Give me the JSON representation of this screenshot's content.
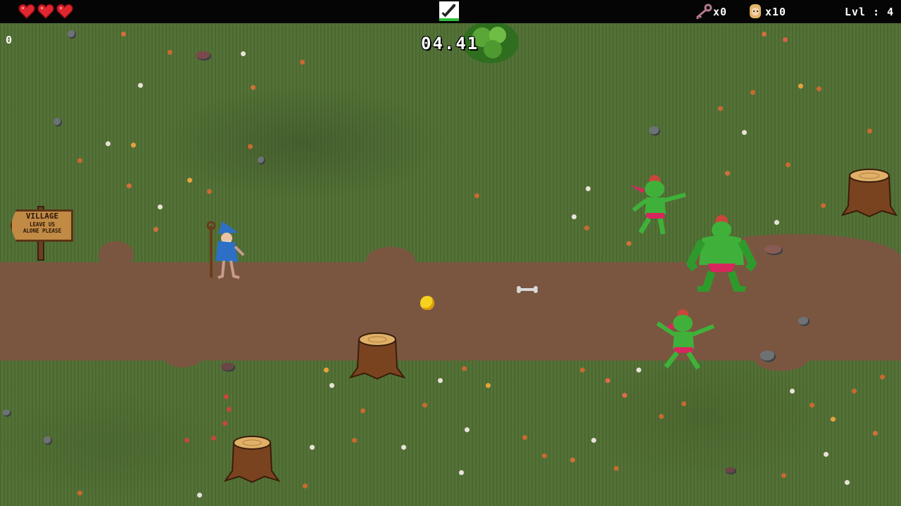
{
  "hud": {
    "hearts": 3,
    "weapon_icon": "sword-icon",
    "keys_label": "x0",
    "allies_label": "x10",
    "level_label": "Lvl : 4"
  },
  "counter": "0",
  "timer": "04.41",
  "sign": {
    "title": "VILLAGE",
    "subtitle_line1": "LEAVE US",
    "subtitle_line2": "ALONE PLEASE"
  },
  "colors": {
    "heart": "#e0262f",
    "grass": "#4f6e32",
    "dirt": "#7a5640",
    "goblin_skin": "#3fb13a",
    "goblin_loincloth": "#d7265d",
    "wizard_robe": "#2c6fc4"
  }
}
